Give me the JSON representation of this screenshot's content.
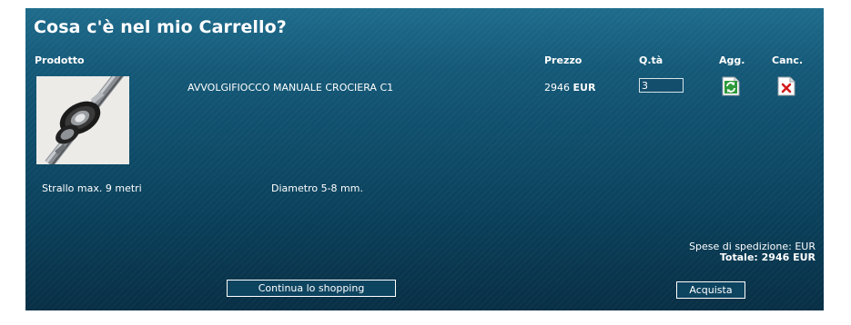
{
  "page": {
    "title": "Cosa c'è nel mio Carrello?"
  },
  "table": {
    "headers": {
      "product": "Prodotto",
      "price": "Prezzo",
      "qty": "Q.tà",
      "update": "Agg.",
      "delete": "Canc."
    }
  },
  "item": {
    "name": "AVVOLGIFIOCCO MANUALE CROCIERA C1",
    "price_value": "2946",
    "price_currency": "EUR",
    "quantity": "3",
    "detail_1": "Strallo max. 9 metri",
    "detail_2": "Diametro 5-8 mm.",
    "image_icon": "roller-furler-product-photo",
    "update_icon": "refresh-icon",
    "delete_icon": "delete-x-icon"
  },
  "summary": {
    "shipping": "Spese di spedizione: EUR",
    "total": "Totale: 2946 EUR"
  },
  "buttons": {
    "continue_label": "Continua lo shopping",
    "buy_label": "Acquista"
  },
  "colors": {
    "panel_top": "#1f6c8c",
    "panel_bottom": "#082f45",
    "text": "#ffffff",
    "refresh_green": "#2e9a3a",
    "delete_red": "#d21c1c"
  }
}
